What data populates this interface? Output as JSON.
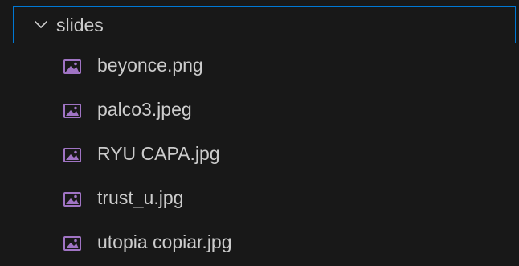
{
  "explorer": {
    "folder": {
      "name": "slides",
      "expanded": true,
      "icon": "chevron-down-icon"
    },
    "files": [
      {
        "name": "beyonce.png",
        "icon": "image-file-icon"
      },
      {
        "name": "palco3.jpeg",
        "icon": "image-file-icon"
      },
      {
        "name": "RYU CAPA.jpg",
        "icon": "image-file-icon"
      },
      {
        "name": "trust_u.jpg",
        "icon": "image-file-icon"
      },
      {
        "name": "utopia copiar.jpg",
        "icon": "image-file-icon"
      }
    ],
    "colors": {
      "background": "#181818",
      "text": "#cccccc",
      "focus_border": "#0078d4",
      "image_icon": "#a074c4"
    }
  }
}
